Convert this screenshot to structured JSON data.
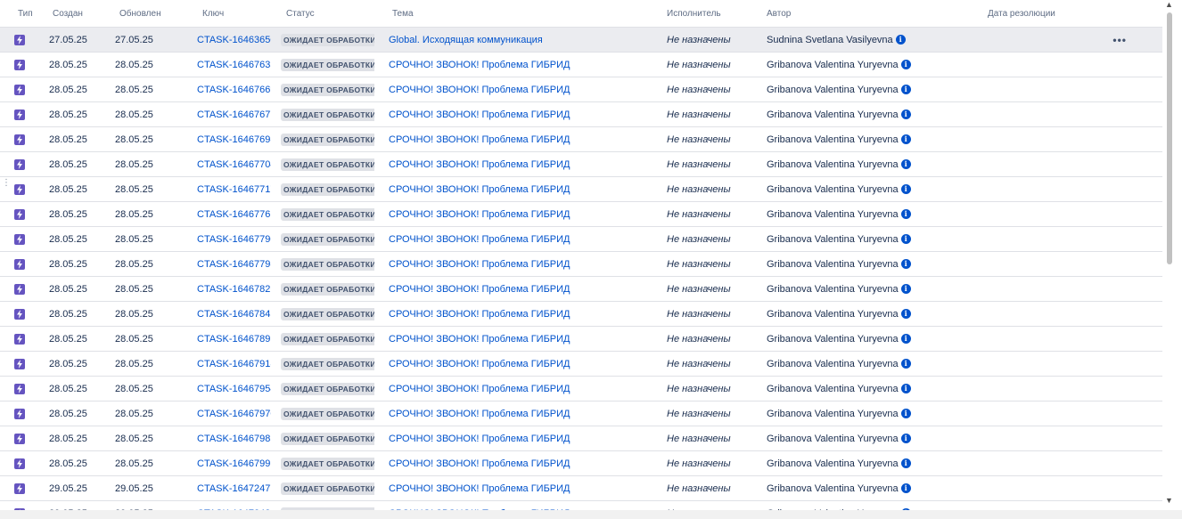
{
  "columns": {
    "type": "Тип",
    "created": "Создан",
    "updated": "Обновлен",
    "key": "Ключ",
    "status": "Статус",
    "summary": "Тема",
    "assignee": "Исполнитель",
    "reporter": "Автор",
    "resolution_date": "Дата резолюции"
  },
  "issues": [
    {
      "created": "27.05.25",
      "updated": "27.05.25",
      "key": "CTASK-16463650",
      "status": "ОЖИДАЕТ ОБРАБОТКИ",
      "summary": "Global. Исходящая коммуникация",
      "assignee": "Не назначены",
      "reporter": "Sudnina Svetlana Vasilyevna",
      "resolution": ""
    },
    {
      "created": "28.05.25",
      "updated": "28.05.25",
      "key": "CTASK-16467635",
      "status": "ОЖИДАЕТ ОБРАБОТКИ",
      "summary": "СРОЧНО! ЗВОНОК! Проблема ГИБРИД",
      "assignee": "Не назначены",
      "reporter": "Gribanova Valentina Yuryevna",
      "resolution": ""
    },
    {
      "created": "28.05.25",
      "updated": "28.05.25",
      "key": "CTASK-16467669",
      "status": "ОЖИДАЕТ ОБРАБОТКИ",
      "summary": "СРОЧНО! ЗВОНОК! Проблема ГИБРИД",
      "assignee": "Не назначены",
      "reporter": "Gribanova Valentina Yuryevna",
      "resolution": ""
    },
    {
      "created": "28.05.25",
      "updated": "28.05.25",
      "key": "CTASK-16467677",
      "status": "ОЖИДАЕТ ОБРАБОТКИ",
      "summary": "СРОЧНО! ЗВОНОК! Проблема ГИБРИД",
      "assignee": "Не назначены",
      "reporter": "Gribanova Valentina Yuryevna",
      "resolution": ""
    },
    {
      "created": "28.05.25",
      "updated": "28.05.25",
      "key": "CTASK-16467698",
      "status": "ОЖИДАЕТ ОБРАБОТКИ",
      "summary": "СРОЧНО! ЗВОНОК! Проблема ГИБРИД",
      "assignee": "Не назначены",
      "reporter": "Gribanova Valentina Yuryevna",
      "resolution": ""
    },
    {
      "created": "28.05.25",
      "updated": "28.05.25",
      "key": "CTASK-16467704",
      "status": "ОЖИДАЕТ ОБРАБОТКИ",
      "summary": "СРОЧНО! ЗВОНОК! Проблема ГИБРИД",
      "assignee": "Не назначены",
      "reporter": "Gribanova Valentina Yuryevna",
      "resolution": ""
    },
    {
      "created": "28.05.25",
      "updated": "28.05.25",
      "key": "CTASK-16467717",
      "status": "ОЖИДАЕТ ОБРАБОТКИ",
      "summary": "СРОЧНО! ЗВОНОК! Проблема ГИБРИД",
      "assignee": "Не назначены",
      "reporter": "Gribanova Valentina Yuryevna",
      "resolution": ""
    },
    {
      "created": "28.05.25",
      "updated": "28.05.25",
      "key": "CTASK-16467761",
      "status": "ОЖИДАЕТ ОБРАБОТКИ",
      "summary": "СРОЧНО! ЗВОНОК! Проблема ГИБРИД",
      "assignee": "Не назначены",
      "reporter": "Gribanova Valentina Yuryevna",
      "resolution": ""
    },
    {
      "created": "28.05.25",
      "updated": "28.05.25",
      "key": "CTASK-16467790",
      "status": "ОЖИДАЕТ ОБРАБОТКИ",
      "summary": "СРОЧНО! ЗВОНОК! Проблема ГИБРИД",
      "assignee": "Не назначены",
      "reporter": "Gribanova Valentina Yuryevna",
      "resolution": ""
    },
    {
      "created": "28.05.25",
      "updated": "28.05.25",
      "key": "CTASK-16467798",
      "status": "ОЖИДАЕТ ОБРАБОТКИ",
      "summary": "СРОЧНО! ЗВОНОК! Проблема ГИБРИД",
      "assignee": "Не назначены",
      "reporter": "Gribanova Valentina Yuryevna",
      "resolution": ""
    },
    {
      "created": "28.05.25",
      "updated": "28.05.25",
      "key": "CTASK-16467826",
      "status": "ОЖИДАЕТ ОБРАБОТКИ",
      "summary": "СРОЧНО! ЗВОНОК! Проблема ГИБРИД",
      "assignee": "Не назначены",
      "reporter": "Gribanova Valentina Yuryevna",
      "resolution": ""
    },
    {
      "created": "28.05.25",
      "updated": "28.05.25",
      "key": "CTASK-16467845",
      "status": "ОЖИДАЕТ ОБРАБОТКИ",
      "summary": "СРОЧНО! ЗВОНОК! Проблема ГИБРИД",
      "assignee": "Не назначены",
      "reporter": "Gribanova Valentina Yuryevna",
      "resolution": ""
    },
    {
      "created": "28.05.25",
      "updated": "28.05.25",
      "key": "CTASK-16467891",
      "status": "ОЖИДАЕТ ОБРАБОТКИ",
      "summary": "СРОЧНО! ЗВОНОК! Проблема ГИБРИД",
      "assignee": "Не назначены",
      "reporter": "Gribanova Valentina Yuryevna",
      "resolution": ""
    },
    {
      "created": "28.05.25",
      "updated": "28.05.25",
      "key": "CTASK-16467918",
      "status": "ОЖИДАЕТ ОБРАБОТКИ",
      "summary": "СРОЧНО! ЗВОНОК! Проблема ГИБРИД",
      "assignee": "Не назначены",
      "reporter": "Gribanova Valentina Yuryevna",
      "resolution": ""
    },
    {
      "created": "28.05.25",
      "updated": "28.05.25",
      "key": "CTASK-16467954",
      "status": "ОЖИДАЕТ ОБРАБОТКИ",
      "summary": "СРОЧНО! ЗВОНОК! Проблема ГИБРИД",
      "assignee": "Не назначены",
      "reporter": "Gribanova Valentina Yuryevna",
      "resolution": ""
    },
    {
      "created": "28.05.25",
      "updated": "28.05.25",
      "key": "CTASK-16467970",
      "status": "ОЖИДАЕТ ОБРАБОТКИ",
      "summary": "СРОЧНО! ЗВОНОК! Проблема ГИБРИД",
      "assignee": "Не назначены",
      "reporter": "Gribanova Valentina Yuryevna",
      "resolution": ""
    },
    {
      "created": "28.05.25",
      "updated": "28.05.25",
      "key": "CTASK-16467985",
      "status": "ОЖИДАЕТ ОБРАБОТКИ",
      "summary": "СРОЧНО! ЗВОНОК! Проблема ГИБРИД",
      "assignee": "Не назначены",
      "reporter": "Gribanova Valentina Yuryevna",
      "resolution": ""
    },
    {
      "created": "28.05.25",
      "updated": "28.05.25",
      "key": "CTASK-16467996",
      "status": "ОЖИДАЕТ ОБРАБОТКИ",
      "summary": "СРОЧНО! ЗВОНОК! Проблема ГИБРИД",
      "assignee": "Не назначены",
      "reporter": "Gribanova Valentina Yuryevna",
      "resolution": ""
    },
    {
      "created": "29.05.25",
      "updated": "29.05.25",
      "key": "CTASK-16472477",
      "status": "ОЖИДАЕТ ОБРАБОТКИ",
      "summary": "СРОЧНО! ЗВОНОК! Проблема ГИБРИД",
      "assignee": "Не назначены",
      "reporter": "Gribanova Valentina Yuryevna",
      "resolution": ""
    },
    {
      "created": "29.05.25",
      "updated": "29.05.25",
      "key": "CTASK-16472488",
      "status": "ОЖИДАЕТ ОБРАБОТКИ",
      "summary": "СРОЧНО! ЗВОНОК! Проблема ГИБРИД",
      "assignee": "Не назначены",
      "reporter": "Gribanova Valentina Yuryevna",
      "resolution": ""
    }
  ],
  "selected_row": 0,
  "icons": {
    "type": "lightning-icon",
    "info": "info-icon",
    "more": "more-actions-icon"
  },
  "colors": {
    "link": "#0052cc",
    "type_icon": "#6554c0",
    "lozenge_bg": "#dfe1e6",
    "selected_row": "#ebecf0"
  }
}
